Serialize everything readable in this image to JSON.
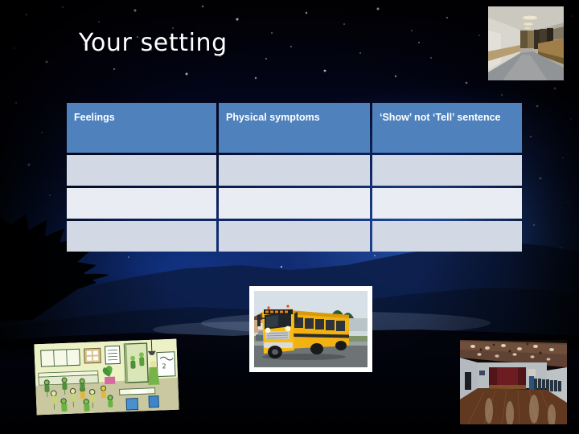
{
  "slide": {
    "title": "Your setting",
    "background_name": "starry-night-landscape",
    "background_colors": {
      "sky_deep": "#0b2a74",
      "sky_dark": "#02030a",
      "ridge": "#0a1b3f"
    }
  },
  "table": {
    "name": "setting-planning-table",
    "header_fill": "#4F81BD",
    "header_text_color": "#FFFFFF",
    "row_fill_dark": "#D3D9E4",
    "row_fill_light": "#E9EDF3",
    "columns": [
      {
        "label": "Feelings"
      },
      {
        "label": "Physical symptoms"
      },
      {
        "label": "‘Show’ not ‘Tell’ sentence"
      }
    ],
    "rows": [
      {
        "cells": [
          "",
          "",
          ""
        ]
      },
      {
        "cells": [
          "",
          "",
          ""
        ]
      },
      {
        "cells": [
          "",
          "",
          ""
        ]
      }
    ]
  },
  "pictures": [
    {
      "name": "school-corridor-photo",
      "caption": "school corridor"
    },
    {
      "name": "classroom-cartoon-illustration",
      "caption": "busy classroom cartoon"
    },
    {
      "name": "school-bus-photo",
      "caption": "yellow school bus"
    },
    {
      "name": "school-hall-photo",
      "caption": "school assembly hall"
    }
  ]
}
